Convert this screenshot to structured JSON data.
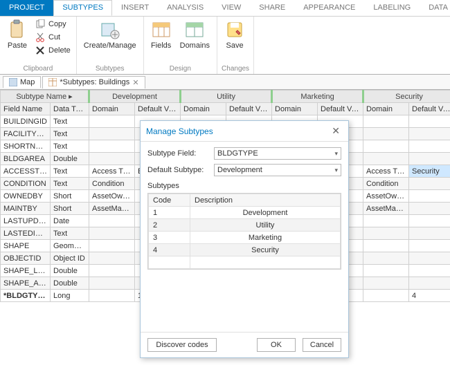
{
  "ribbon": {
    "tabs": [
      "PROJECT",
      "SUBTYPES",
      "INSERT",
      "ANALYSIS",
      "VIEW",
      "SHARE",
      "APPEARANCE",
      "LABELING",
      "DATA"
    ],
    "active_tab_index": 1,
    "groups": {
      "clipboard": {
        "label": "Clipboard",
        "paste": "Paste",
        "copy": "Copy",
        "cut": "Cut",
        "delete": "Delete"
      },
      "subtypes": {
        "label": "Subtypes",
        "create_manage": "Create/Manage"
      },
      "design": {
        "label": "Design",
        "fields": "Fields",
        "domains": "Domains"
      },
      "changes": {
        "label": "Changes",
        "save": "Save"
      }
    }
  },
  "doc_tabs": {
    "items": [
      {
        "label": "Map",
        "closable": false
      },
      {
        "label": "*Subtypes:  Buildings",
        "closable": true
      }
    ],
    "active_index": 1
  },
  "grid": {
    "subtype_name_header": "Subtype Name ▸",
    "groups": [
      "Development",
      "Utility",
      "Marketing",
      "Security"
    ],
    "sub_headers": [
      "Field Name",
      "Data Type",
      "Domain",
      "Default Value",
      "Domain",
      "Default Value",
      "Domain",
      "Default Value",
      "Domain",
      "Default Value"
    ],
    "rows": [
      {
        "field": "BUILDINGID",
        "type": "Text"
      },
      {
        "field": "FACILITYKEY",
        "type": "Text"
      },
      {
        "field": "SHORTNAME",
        "type": "Text"
      },
      {
        "field": "BLDGAREA",
        "type": "Double"
      },
      {
        "field": "ACCESSTYPE",
        "type": "Text",
        "dev_domain": "Access Type",
        "dev_default": "Emp",
        "sec_domain": "Access Type",
        "sec_default": "Security",
        "sec_hl": true
      },
      {
        "field": "CONDITION",
        "type": "Text",
        "dev_domain": "Condition",
        "sec_domain": "Condition"
      },
      {
        "field": "OWNEDBY",
        "type": "Short",
        "dev_domain": "AssetOwner",
        "sec_domain": "AssetOwner"
      },
      {
        "field": "MAINTBY",
        "type": "Short",
        "dev_domain": "AssetManager",
        "sec_domain": "AssetManager"
      },
      {
        "field": "LASTUPDATE",
        "type": "Date"
      },
      {
        "field": "LASTEDITOR",
        "type": "Text"
      },
      {
        "field": "SHAPE",
        "type": "Geometry"
      },
      {
        "field": "OBJECTID",
        "type": "Object ID"
      },
      {
        "field": "SHAPE_Length",
        "type": "Double"
      },
      {
        "field": "SHAPE_Area",
        "type": "Double"
      },
      {
        "field": "*BLDGTYPE",
        "type": "Long",
        "bold": true,
        "dev_default": "1",
        "sec_default": "4"
      }
    ]
  },
  "dialog": {
    "title": "Manage Subtypes",
    "subtype_field_label": "Subtype Field:",
    "subtype_field_value": "BLDGTYPE",
    "default_subtype_label": "Default Subtype:",
    "default_subtype_value": "Development",
    "subtypes_label": "Subtypes",
    "columns": {
      "code": "Code",
      "desc": "Description"
    },
    "rows": [
      {
        "code": "1",
        "desc": "Development"
      },
      {
        "code": "2",
        "desc": "Utility"
      },
      {
        "code": "3",
        "desc": "Marketing"
      },
      {
        "code": "4",
        "desc": "Security"
      }
    ],
    "buttons": {
      "discover": "Discover codes",
      "ok": "OK",
      "cancel": "Cancel"
    }
  }
}
